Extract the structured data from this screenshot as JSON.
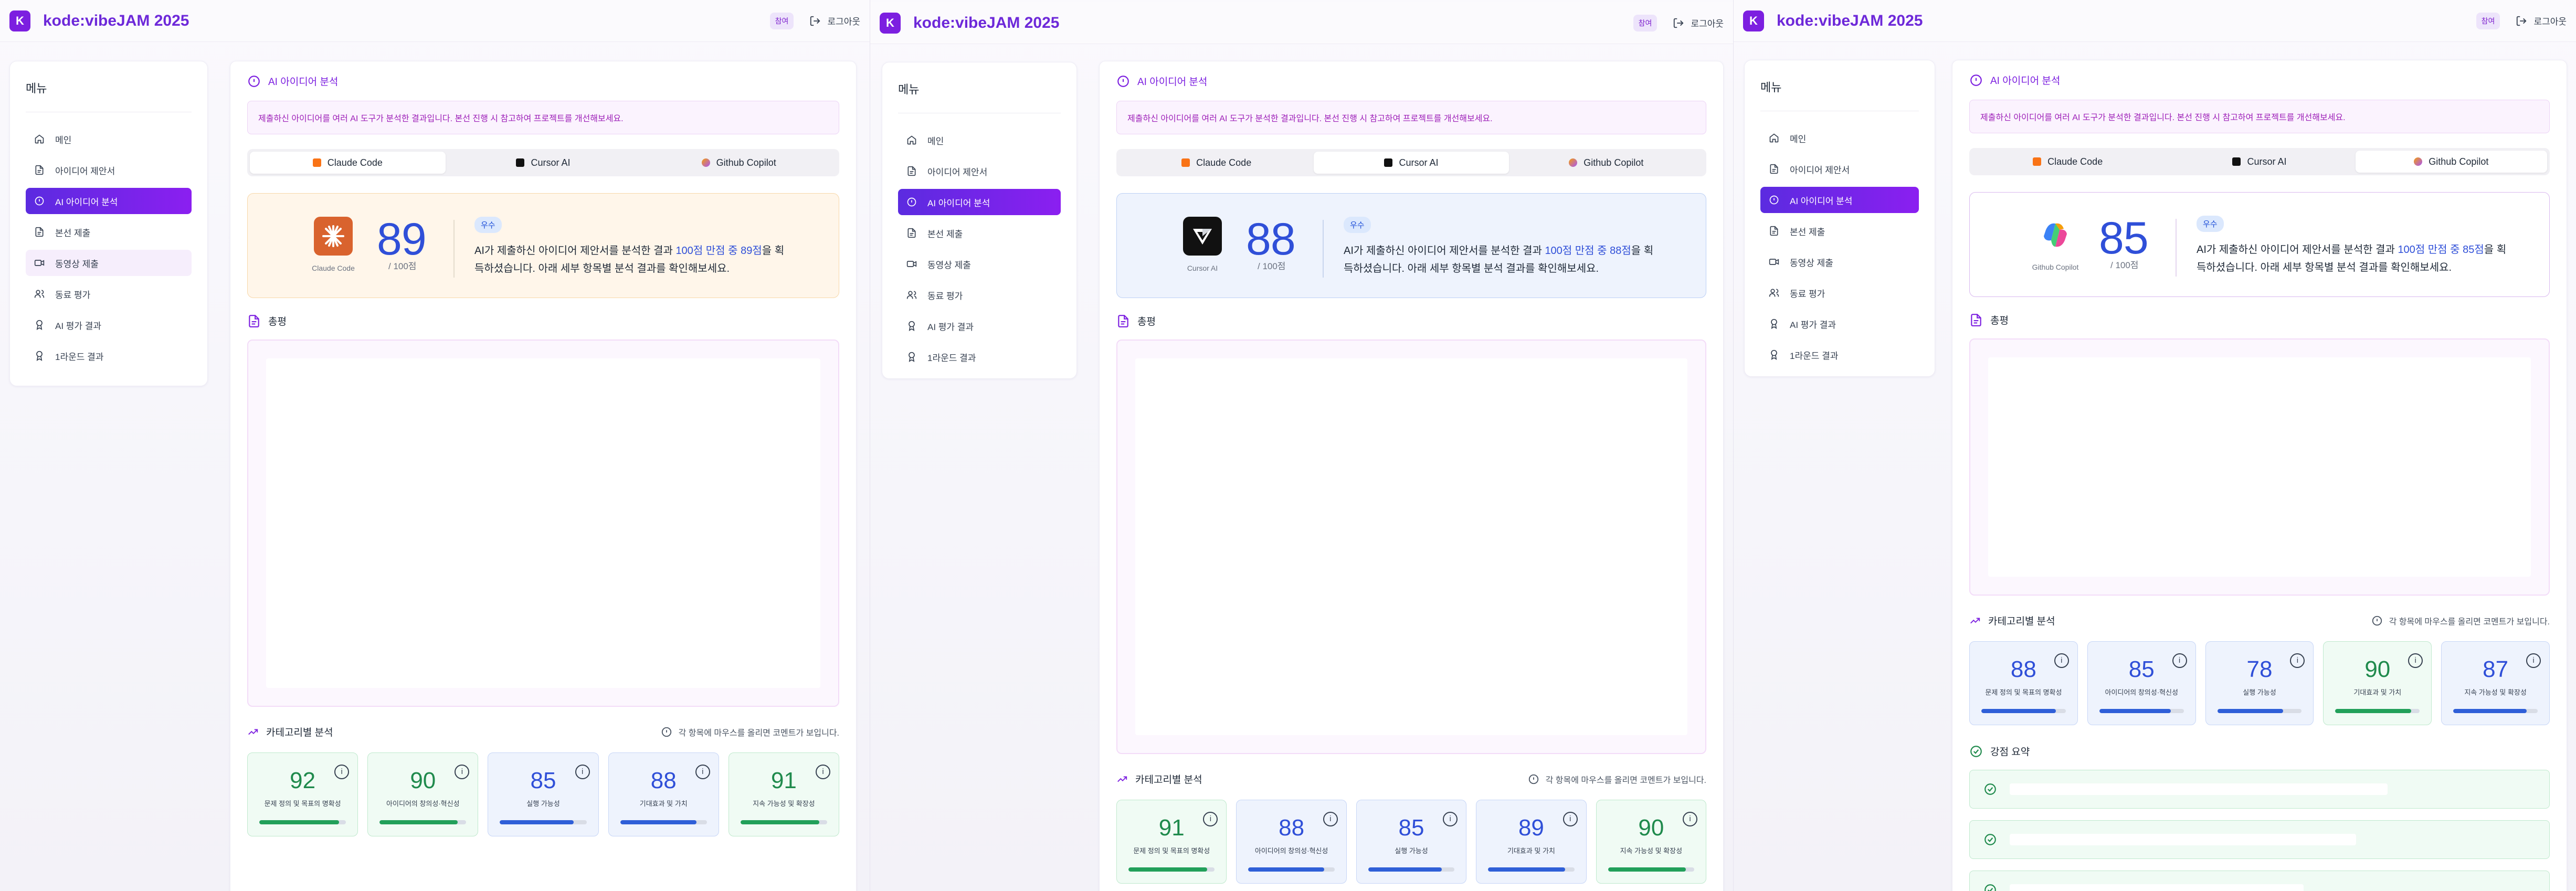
{
  "brand": {
    "logo_letter": "K",
    "name": "kode:vibeJAM 2025"
  },
  "header": {
    "role_badge": "참여",
    "logout_label": "로그아웃"
  },
  "sidebar": {
    "title": "메뉴",
    "items": [
      {
        "label": "메인",
        "icon": "home-icon"
      },
      {
        "label": "아이디어 제안서",
        "icon": "document-icon"
      },
      {
        "label": "AI 아이디어 분석",
        "icon": "info-circle-icon"
      },
      {
        "label": "본선 제출",
        "icon": "document-icon"
      },
      {
        "label": "동영상 제출",
        "icon": "video-icon"
      },
      {
        "label": "동료 평가",
        "icon": "users-icon"
      },
      {
        "label": "AI 평가 결과",
        "icon": "award-icon"
      },
      {
        "label": "1라운드 결과",
        "icon": "award-icon"
      }
    ],
    "active_index": 2
  },
  "analysis": {
    "title": "AI 아이디어 분석",
    "notice": "제출하신 아이디어를 여러 AI 도구가 분석한 결과입니다. 본선 진행 시 참고하여 프로젝트를 개선해보세요.",
    "tabs": [
      "Claude Code",
      "Cursor AI",
      "Github Copilot"
    ],
    "per_label": "/ 100점",
    "grade": "우수",
    "desc_prefix": "AI가 제출하신 아이디어 제안서를 분석한 결과 ",
    "desc_suffix": "을 획득하셨습니다. 아래 세부 항목별 분석 결과를 확인해보세요.",
    "summary_title": "총평",
    "category_title": "카테고리별 분석",
    "category_hint": "각 항목에 마우스를 올리면 코멘트가 보입니다.",
    "strength_title": "강점 요약",
    "info_glyph": "i",
    "category_labels": [
      "문제 정의 및 목표의 명확성",
      "아이디어의 창의성·혁신성",
      "실행 가능성",
      "기대효과 및 가치",
      "지속 가능성 및 확장성"
    ]
  },
  "panels": [
    {
      "active_tab": 0,
      "tool": "Claude Code",
      "score": 89,
      "score_highlight": "100점 만점 중 89점",
      "accent": "#f59e0b",
      "category_scores": [
        92,
        90,
        85,
        88,
        91
      ]
    },
    {
      "active_tab": 1,
      "tool": "Cursor AI",
      "score": 88,
      "score_highlight": "100점 만점 중 88점",
      "accent": "#2563eb",
      "category_scores": [
        91,
        88,
        85,
        89,
        90
      ]
    },
    {
      "active_tab": 2,
      "tool": "Github Copilot",
      "score": 85,
      "score_highlight": "100점 만점 중 85점",
      "accent": "#a855f7",
      "category_scores": [
        88,
        85,
        78,
        90,
        87
      ]
    }
  ],
  "colors": {
    "brand": "#7c1fe0",
    "score_blue": "#2f4fd8",
    "green": "#1f8a4c"
  }
}
